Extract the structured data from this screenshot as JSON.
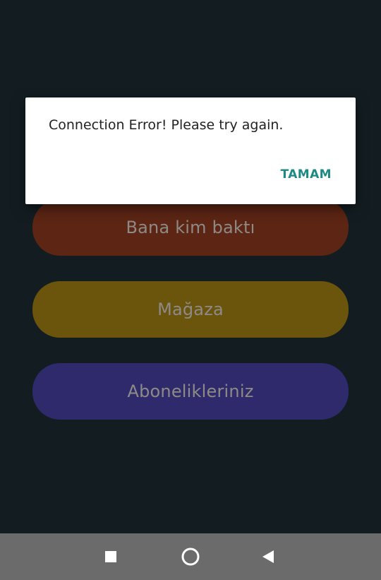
{
  "colors": {
    "background": "#131d21",
    "button_1": "#5c2514",
    "button_2": "#6b540b",
    "button_3": "#2e2a6c",
    "button_text": "#8e8a86",
    "dialog_bg": "#ffffff",
    "dialog_text": "#222222",
    "accent": "#1f8a84",
    "nav_bar": "#6b6b6b",
    "nav_icon": "#ffffff"
  },
  "menu": {
    "items": [
      {
        "label": "Bana kim baktı"
      },
      {
        "label": "Mağaza"
      },
      {
        "label": "Abonelikleriniz"
      }
    ]
  },
  "dialog": {
    "message": "Connection Error! Please try again.",
    "ok_label": "TAMAM"
  },
  "navigation": {
    "recents_icon": "square-icon",
    "home_icon": "circle-icon",
    "back_icon": "triangle-back-icon"
  }
}
